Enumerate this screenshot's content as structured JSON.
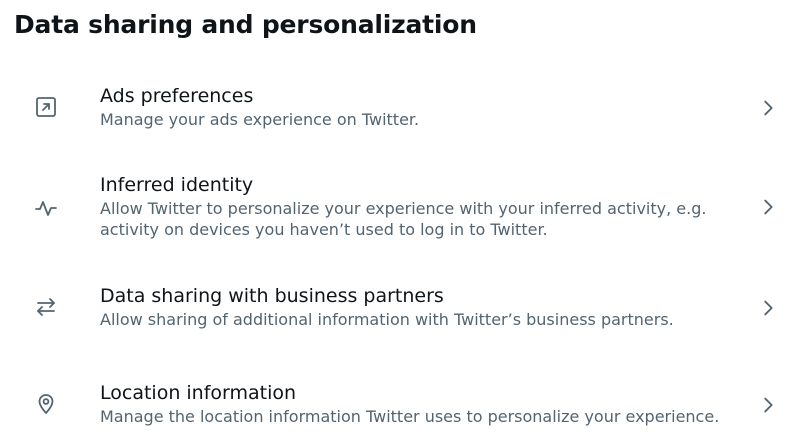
{
  "section": {
    "title": "Data sharing and personalization"
  },
  "items": [
    {
      "icon": "external-arrow-icon",
      "label": "Ads preferences",
      "description": "Manage your ads experience on Twitter."
    },
    {
      "icon": "activity-icon",
      "label": "Inferred identity",
      "description": "Allow Twitter to personalize your experience with your inferred activity, e.g. activity on devices you haven’t used to log in to Twitter."
    },
    {
      "icon": "arrows-swap-icon",
      "label": "Data sharing with business partners",
      "description": "Allow sharing of additional information with Twitter’s business partners."
    },
    {
      "icon": "location-pin-icon",
      "label": "Location information",
      "description": "Manage the location information Twitter uses to personalize your experience."
    }
  ],
  "colors": {
    "primary_text": "#0f1419",
    "secondary_text": "#536471",
    "icon": "#536471",
    "background": "#ffffff"
  }
}
